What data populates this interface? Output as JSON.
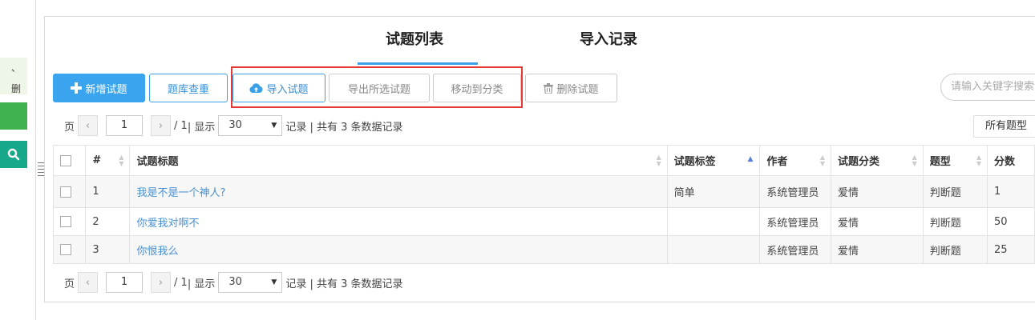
{
  "sidebar": {
    "fragment_text": "、 删"
  },
  "tabs": [
    {
      "label": "试题列表",
      "active": true
    },
    {
      "label": "导入记录",
      "active": false
    }
  ],
  "toolbar": {
    "add_label": "新增试题",
    "check_dup_label": "题库查重",
    "import_label": "导入试题",
    "export_selected_label": "导出所选试题",
    "move_category_label": "移动到分类",
    "delete_label": "删除试题"
  },
  "search": {
    "placeholder": "请输入关键字搜索试题"
  },
  "pager": {
    "page_prefix": "页",
    "current_page": "1",
    "total_pages_text": "/ 1",
    "show_label": "| 显示",
    "page_size": "30",
    "records_text": "记录 | 共有 3 条数据记录"
  },
  "type_filter": {
    "selected": "所有题型"
  },
  "table": {
    "columns": [
      "#",
      "试题标题",
      "试题标签",
      "作者",
      "试题分类",
      "题型",
      "分数"
    ],
    "rows": [
      {
        "num": "1",
        "title": "我是不是一个神人?",
        "tag": "简单",
        "author": "系统管理员",
        "category": "爱情",
        "type": "判断题",
        "score": "1"
      },
      {
        "num": "2",
        "title": "你爱我对啊不",
        "tag": "",
        "author": "系统管理员",
        "category": "爱情",
        "type": "判断题",
        "score": "50"
      },
      {
        "num": "3",
        "title": "你恨我么",
        "tag": "",
        "author": "系统管理员",
        "category": "爱情",
        "type": "判断题",
        "score": "25"
      }
    ]
  },
  "colors": {
    "primary": "#3aa4ee",
    "highlight_box": "#e53935",
    "sidebar_green": "#3fb34f",
    "sidebar_teal": "#17a88b",
    "link": "#4a90d0"
  }
}
